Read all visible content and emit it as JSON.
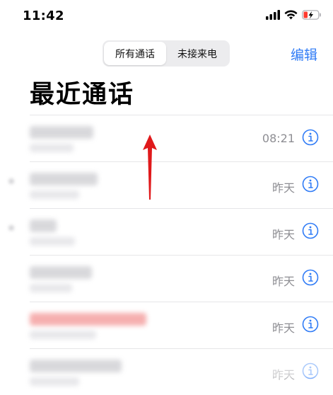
{
  "status_bar": {
    "time": "11:42",
    "icons": [
      "cellular-signal-icon",
      "wifi-icon",
      "battery-charging-icon"
    ],
    "battery_color": "#ff3b30"
  },
  "segment": {
    "all_label": "所有通话",
    "missed_label": "未接来电",
    "selected": "所有通话"
  },
  "header": {
    "edit_label": "编辑",
    "title": "最近通话"
  },
  "calls": [
    {
      "time": "08:21",
      "missed": false
    },
    {
      "time": "昨天",
      "missed": false
    },
    {
      "time": "昨天",
      "missed": false
    },
    {
      "time": "昨天",
      "missed": false
    },
    {
      "time": "昨天",
      "missed": true
    },
    {
      "time": "昨天",
      "missed": false
    }
  ],
  "colors": {
    "accent": "#2f7bf6",
    "secondary_text": "#8e8e93",
    "missed": "#ff3b30",
    "annotation_arrow": "#e0191b"
  }
}
